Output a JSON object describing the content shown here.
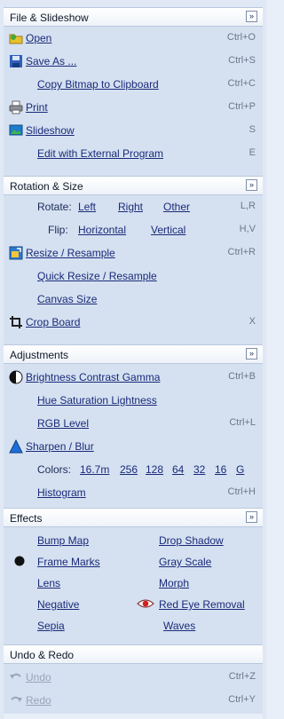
{
  "file": {
    "title": "File & Slideshow",
    "collapse": "»",
    "open": "Open",
    "open_sc": "Ctrl+O",
    "save_as": "Save As ...",
    "save_sc": "Ctrl+S",
    "copy_bitmap": "Copy Bitmap to Clipboard",
    "copy_sc": "Ctrl+C",
    "print": "Print",
    "print_sc": "Ctrl+P",
    "slideshow": "Slideshow",
    "slideshow_sc": "S",
    "edit_external": "Edit with External Program",
    "edit_sc": "E"
  },
  "rotation": {
    "title": "Rotation & Size",
    "collapse": "»",
    "rotate_label": "Rotate:",
    "left": "Left",
    "right": "Right",
    "other": "Other",
    "rotate_sc": "L,R",
    "flip_label": "Flip:",
    "horizontal": "Horizontal",
    "vertical": "Vertical",
    "flip_sc": "H,V",
    "resize": "Resize / Resample",
    "resize_sc": "Ctrl+R",
    "quick_resize": "Quick Resize / Resample",
    "canvas_size": "Canvas Size",
    "crop_board": "Crop Board",
    "crop_sc": "X"
  },
  "adjustments": {
    "title": "Adjustments",
    "collapse": "»",
    "bcg": "Brightness  Contrast  Gamma",
    "bcg_sc": "Ctrl+B",
    "hsl": "Hue  Saturation  Lightness",
    "rgb": "RGB Level",
    "rgb_sc": "Ctrl+L",
    "sharpen": "Sharpen / Blur",
    "colors_label": "Colors:",
    "colors": [
      "16.7m",
      "256",
      "128",
      "64",
      "32",
      "16",
      "G"
    ],
    "histogram": "Histogram",
    "histogram_sc": "Ctrl+H"
  },
  "effects": {
    "title": "Effects",
    "collapse": "»",
    "bump_map": "Bump Map",
    "drop_shadow": "Drop Shadow",
    "frame_marks": "Frame Marks",
    "gray_scale": "Gray Scale",
    "lens": "Lens",
    "morph": "Morph",
    "negative": "Negative",
    "red_eye": "Red Eye Removal",
    "sepia": "Sepia",
    "waves": "Waves"
  },
  "undo": {
    "title": "Undo & Redo",
    "undo": "Undo",
    "undo_sc": "Ctrl+Z",
    "redo": "Redo",
    "redo_sc": "Ctrl+Y"
  }
}
